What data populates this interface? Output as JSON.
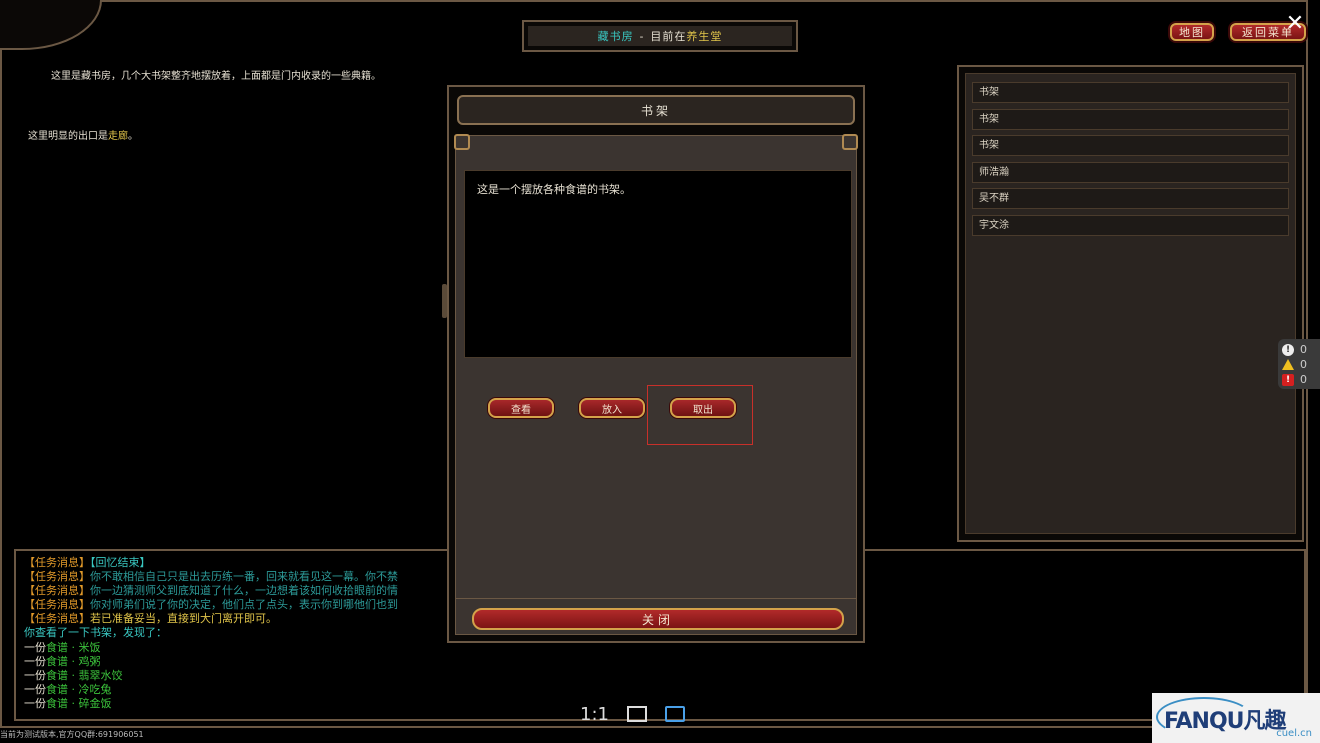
{
  "title_bar": {
    "location": "藏书房",
    "separator": "-",
    "current_prefix": "目前在",
    "place": "养生堂"
  },
  "top_buttons": {
    "map": "地图",
    "return": "返回菜单"
  },
  "close_symbol": "✕",
  "room": {
    "description": "这里是藏书房，几个大书架整齐地摆放着，上面都是门内收录的一些典籍。",
    "exit_prefix": "这里明显的出口是",
    "exit_name": "走廊",
    "exit_suffix": "。"
  },
  "list": {
    "items": [
      "书架",
      "书架",
      "书架",
      "师浩瀚",
      "吴不群",
      "宇文涂"
    ]
  },
  "alerts": {
    "info_count": "0",
    "warn_count": "0",
    "error_count": "0"
  },
  "log": {
    "lines": [
      {
        "tag": "【任务消息】",
        "text": "【回忆结束】"
      },
      {
        "tag": "【任务消息】",
        "text": "你不敢相信自己只是出去历练一番，回来就看见这一幕。你不禁"
      },
      {
        "tag": "【任务消息】",
        "text": "你一边猜测师父到底知道了什么，一边想着该如何收拾眼前的情"
      },
      {
        "tag": "【任务消息】",
        "text": "你对师弟们说了你的决定，他们点了点头，表示你到哪他们也到"
      },
      {
        "tag": "【任务消息】",
        "text": "若已准备妥当，直接到大门离开即可。"
      }
    ],
    "found_line": "你查看了一下书架，发现了：",
    "found_items": [
      {
        "prefix": "一份",
        "cat": "食谱",
        "sep": "·",
        "name": "米饭"
      },
      {
        "prefix": "一份",
        "cat": "食谱",
        "sep": "·",
        "name": "鸡粥"
      },
      {
        "prefix": "一份",
        "cat": "食谱",
        "sep": "·",
        "name": "翡翠水饺"
      },
      {
        "prefix": "一份",
        "cat": "食谱",
        "sep": "·",
        "name": "冷吃兔"
      },
      {
        "prefix": "一份",
        "cat": "食谱",
        "sep": "·",
        "name": "碎金饭"
      }
    ]
  },
  "modal": {
    "title": "书架",
    "description": "这是一个摆放各种食谱的书架。",
    "buttons": {
      "view": "查看",
      "put": "放入",
      "take": "取出"
    },
    "close": "关闭"
  },
  "viewer": {
    "ratio": "1:1"
  },
  "footer": "当前为测试版本,官方QQ群:691906051",
  "watermark": {
    "brand": "FANQU凡趣",
    "sub": "cuel.cn"
  },
  "colors": {
    "frame": "#6b5844",
    "button_red": "#b12a2a",
    "button_border": "#d4a24a",
    "cyan": "#39c6c0",
    "yellow": "#e0c44a",
    "orange": "#e29a2a",
    "green": "#3cc43c"
  }
}
